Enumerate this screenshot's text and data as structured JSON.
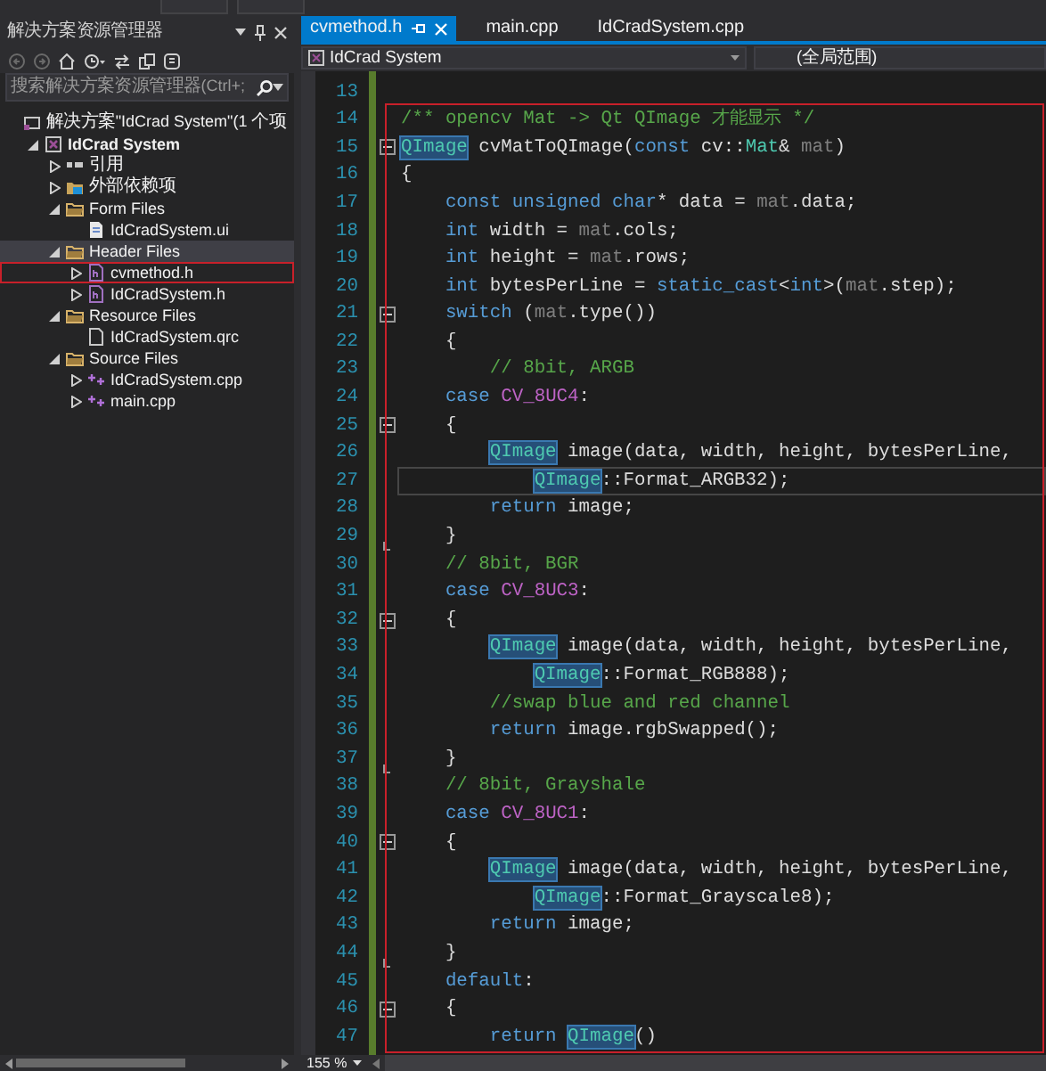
{
  "solution_explorer": {
    "title": "解决方案资源管理器",
    "search": {
      "placeholder": "搜索解决方案资源管理器(Ctrl+;"
    },
    "tree": [
      {
        "label": "解决方案\"IdCrad System\"(1 个项",
        "kind": "solution",
        "selected": false,
        "outlined": false,
        "children": [
          {
            "label": "IdCrad System",
            "kind": "project",
            "expanded": true,
            "selected": false,
            "outlined": false,
            "children": [
              {
                "label": "引用",
                "kind": "references",
                "expanded": false,
                "selected": false,
                "outlined": false
              },
              {
                "label": "外部依赖项",
                "kind": "external",
                "expanded": false,
                "selected": false,
                "outlined": false
              },
              {
                "label": "Form Files",
                "kind": "folder",
                "expanded": true,
                "selected": false,
                "outlined": false,
                "children": [
                  {
                    "label": "IdCradSystem.ui",
                    "kind": "ui",
                    "selected": false,
                    "outlined": false
                  }
                ]
              },
              {
                "label": "Header Files",
                "kind": "folder",
                "expanded": true,
                "selected": true,
                "outlined": false,
                "children": [
                  {
                    "label": "cvmethod.h",
                    "kind": "header",
                    "expanded": false,
                    "selected": false,
                    "outlined": true
                  },
                  {
                    "label": "IdCradSystem.h",
                    "kind": "header",
                    "expanded": false,
                    "selected": false,
                    "outlined": false
                  }
                ]
              },
              {
                "label": "Resource Files",
                "kind": "folder",
                "expanded": true,
                "selected": false,
                "outlined": false,
                "children": [
                  {
                    "label": "IdCradSystem.qrc",
                    "kind": "resource",
                    "selected": false,
                    "outlined": false
                  }
                ]
              },
              {
                "label": "Source Files",
                "kind": "folder",
                "expanded": true,
                "selected": false,
                "outlined": false,
                "children": [
                  {
                    "label": "IdCradSystem.cpp",
                    "kind": "source",
                    "expanded": false,
                    "selected": false,
                    "outlined": false
                  },
                  {
                    "label": "main.cpp",
                    "kind": "source",
                    "expanded": false,
                    "selected": false,
                    "outlined": false
                  }
                ]
              }
            ]
          }
        ]
      }
    ]
  },
  "editor": {
    "tabs": [
      {
        "label": "cvmethod.h",
        "selected": true
      },
      {
        "label": "main.cpp",
        "selected": false
      },
      {
        "label": "IdCradSystem.cpp",
        "selected": false
      }
    ],
    "navigation": {
      "project": "IdCrad System",
      "scope": "(全局范围)"
    },
    "lines_above_frame": [
      {
        "number": "13",
        "collapsible": false,
        "block_end": false,
        "current": false
      }
    ],
    "framed_lines": [
      {
        "number": "14",
        "collapsible": false,
        "block_end": false,
        "current": false,
        "tokens": [
          {
            "kind": "comment",
            "text": "/** opencv Mat -> Qt QImage 才能显示 */"
          }
        ]
      },
      {
        "number": "15",
        "collapsible": true,
        "block_end": false,
        "current": false,
        "tokens": [
          {
            "kind": "highlight",
            "text": "QImage"
          },
          {
            "kind": "plain",
            "text": " cvMatToQImage("
          },
          {
            "kind": "keyword",
            "text": "const"
          },
          {
            "kind": "plain",
            "text": " cv::"
          },
          {
            "kind": "type",
            "text": "Mat"
          },
          {
            "kind": "plain",
            "text": "& "
          },
          {
            "kind": "member",
            "text": "mat"
          },
          {
            "kind": "plain",
            "text": ")"
          }
        ]
      },
      {
        "number": "16",
        "collapsible": false,
        "block_end": false,
        "current": false,
        "tokens": [
          {
            "kind": "plain",
            "text": "{"
          }
        ]
      },
      {
        "number": "17",
        "collapsible": false,
        "block_end": false,
        "current": false,
        "tokens": [
          {
            "kind": "keyword",
            "text": "    const"
          },
          {
            "kind": "keyword",
            "text": " unsigned"
          },
          {
            "kind": "keyword",
            "text": " char"
          },
          {
            "kind": "plain",
            "text": "* data = "
          },
          {
            "kind": "member",
            "text": "mat"
          },
          {
            "kind": "plain",
            "text": ".data;"
          }
        ]
      },
      {
        "number": "18",
        "collapsible": false,
        "block_end": false,
        "current": false,
        "tokens": [
          {
            "kind": "keyword",
            "text": "    int"
          },
          {
            "kind": "plain",
            "text": " width = "
          },
          {
            "kind": "member",
            "text": "mat"
          },
          {
            "kind": "plain",
            "text": ".cols;"
          }
        ]
      },
      {
        "number": "19",
        "collapsible": false,
        "block_end": false,
        "current": false,
        "tokens": [
          {
            "kind": "keyword",
            "text": "    int"
          },
          {
            "kind": "plain",
            "text": " height = "
          },
          {
            "kind": "member",
            "text": "mat"
          },
          {
            "kind": "plain",
            "text": ".rows;"
          }
        ]
      },
      {
        "number": "20",
        "collapsible": false,
        "block_end": false,
        "current": false,
        "tokens": [
          {
            "kind": "keyword",
            "text": "    int"
          },
          {
            "kind": "plain",
            "text": " bytesPerLine = "
          },
          {
            "kind": "keyword",
            "text": "static_cast"
          },
          {
            "kind": "plain",
            "text": "<"
          },
          {
            "kind": "keyword",
            "text": "int"
          },
          {
            "kind": "plain",
            "text": ">("
          },
          {
            "kind": "member",
            "text": "mat"
          },
          {
            "kind": "plain",
            "text": ".step);"
          }
        ]
      },
      {
        "number": "21",
        "collapsible": true,
        "block_end": false,
        "current": false,
        "tokens": [
          {
            "kind": "keyword",
            "text": "    switch"
          },
          {
            "kind": "plain",
            "text": " ("
          },
          {
            "kind": "member",
            "text": "mat"
          },
          {
            "kind": "plain",
            "text": ".type())"
          }
        ]
      },
      {
        "number": "22",
        "collapsible": false,
        "block_end": false,
        "current": false,
        "tokens": [
          {
            "kind": "plain",
            "text": "    {"
          }
        ]
      },
      {
        "number": "23",
        "collapsible": false,
        "block_end": false,
        "current": false,
        "tokens": [
          {
            "kind": "comment",
            "text": "        // 8bit, ARGB"
          }
        ]
      },
      {
        "number": "24",
        "collapsible": false,
        "block_end": false,
        "current": false,
        "tokens": [
          {
            "kind": "keyword",
            "text": "    case"
          },
          {
            "kind": "macro",
            "text": " CV_8UC4"
          },
          {
            "kind": "plain",
            "text": ":"
          }
        ]
      },
      {
        "number": "25",
        "collapsible": true,
        "block_end": false,
        "current": false,
        "tokens": [
          {
            "kind": "plain",
            "text": "    {"
          }
        ]
      },
      {
        "number": "26",
        "collapsible": false,
        "block_end": false,
        "current": false,
        "tokens": [
          {
            "kind": "highlight",
            "text": "        QImage"
          },
          {
            "kind": "plain",
            "text": " image(data, width, height, bytesPerLine,"
          }
        ]
      },
      {
        "number": "27",
        "collapsible": false,
        "block_end": false,
        "current": true,
        "tokens": [
          {
            "kind": "highlight",
            "text": "            QImage"
          },
          {
            "kind": "plain",
            "text": "::Format_ARGB32);"
          }
        ]
      },
      {
        "number": "28",
        "collapsible": false,
        "block_end": false,
        "current": false,
        "tokens": [
          {
            "kind": "keyword",
            "text": "        return"
          },
          {
            "kind": "plain",
            "text": " image;"
          }
        ]
      },
      {
        "number": "29",
        "collapsible": false,
        "block_end": true,
        "current": false,
        "tokens": [
          {
            "kind": "plain",
            "text": "    }"
          }
        ]
      },
      {
        "number": "30",
        "collapsible": false,
        "block_end": false,
        "current": false,
        "tokens": [
          {
            "kind": "comment",
            "text": "    // 8bit, BGR"
          }
        ]
      },
      {
        "number": "31",
        "collapsible": false,
        "block_end": false,
        "current": false,
        "tokens": [
          {
            "kind": "keyword",
            "text": "    case"
          },
          {
            "kind": "macro",
            "text": " CV_8UC3"
          },
          {
            "kind": "plain",
            "text": ":"
          }
        ]
      },
      {
        "number": "32",
        "collapsible": true,
        "block_end": false,
        "current": false,
        "tokens": [
          {
            "kind": "plain",
            "text": "    {"
          }
        ]
      },
      {
        "number": "33",
        "collapsible": false,
        "block_end": false,
        "current": false,
        "tokens": [
          {
            "kind": "highlight",
            "text": "        QImage"
          },
          {
            "kind": "plain",
            "text": " image(data, width, height, bytesPerLine,"
          }
        ]
      },
      {
        "number": "34",
        "collapsible": false,
        "block_end": false,
        "current": false,
        "tokens": [
          {
            "kind": "highlight",
            "text": "            QImage"
          },
          {
            "kind": "plain",
            "text": "::Format_RGB888);"
          }
        ]
      },
      {
        "number": "35",
        "collapsible": false,
        "block_end": false,
        "current": false,
        "tokens": [
          {
            "kind": "comment",
            "text": "        //swap blue and red channel"
          }
        ]
      },
      {
        "number": "36",
        "collapsible": false,
        "block_end": false,
        "current": false,
        "tokens": [
          {
            "kind": "keyword",
            "text": "        return"
          },
          {
            "kind": "plain",
            "text": " image.rgbSwapped();"
          }
        ]
      },
      {
        "number": "37",
        "collapsible": false,
        "block_end": true,
        "current": false,
        "tokens": [
          {
            "kind": "plain",
            "text": "    }"
          }
        ]
      },
      {
        "number": "38",
        "collapsible": false,
        "block_end": false,
        "current": false,
        "tokens": [
          {
            "kind": "comment",
            "text": "    // 8bit, Grayshale"
          }
        ]
      },
      {
        "number": "39",
        "collapsible": false,
        "block_end": false,
        "current": false,
        "tokens": [
          {
            "kind": "keyword",
            "text": "    case"
          },
          {
            "kind": "macro",
            "text": " CV_8UC1"
          },
          {
            "kind": "plain",
            "text": ":"
          }
        ]
      },
      {
        "number": "40",
        "collapsible": true,
        "block_end": false,
        "current": false,
        "tokens": [
          {
            "kind": "plain",
            "text": "    {"
          }
        ]
      },
      {
        "number": "41",
        "collapsible": false,
        "block_end": false,
        "current": false,
        "tokens": [
          {
            "kind": "highlight",
            "text": "        QImage"
          },
          {
            "kind": "plain",
            "text": " image(data, width, height, bytesPerLine,"
          }
        ]
      },
      {
        "number": "42",
        "collapsible": false,
        "block_end": false,
        "current": false,
        "tokens": [
          {
            "kind": "highlight",
            "text": "            QImage"
          },
          {
            "kind": "plain",
            "text": "::Format_Grayscale8);"
          }
        ]
      },
      {
        "number": "43",
        "collapsible": false,
        "block_end": false,
        "current": false,
        "tokens": [
          {
            "kind": "keyword",
            "text": "        return"
          },
          {
            "kind": "plain",
            "text": " image;"
          }
        ]
      },
      {
        "number": "44",
        "collapsible": false,
        "block_end": true,
        "current": false,
        "tokens": [
          {
            "kind": "plain",
            "text": "    }"
          }
        ]
      },
      {
        "number": "45",
        "collapsible": false,
        "block_end": false,
        "current": false,
        "tokens": [
          {
            "kind": "keyword",
            "text": "    default"
          },
          {
            "kind": "plain",
            "text": ":"
          }
        ]
      },
      {
        "number": "46",
        "collapsible": true,
        "block_end": false,
        "current": false,
        "tokens": [
          {
            "kind": "plain",
            "text": "    {"
          }
        ]
      },
      {
        "number": "47",
        "collapsible": false,
        "block_end": false,
        "current": false,
        "tokens": [
          {
            "kind": "keyword",
            "text": "        return "
          },
          {
            "kind": "highlight",
            "text": "QImage"
          },
          {
            "kind": "plain",
            "text": "()"
          }
        ]
      }
    ],
    "zoom": "155 %"
  }
}
